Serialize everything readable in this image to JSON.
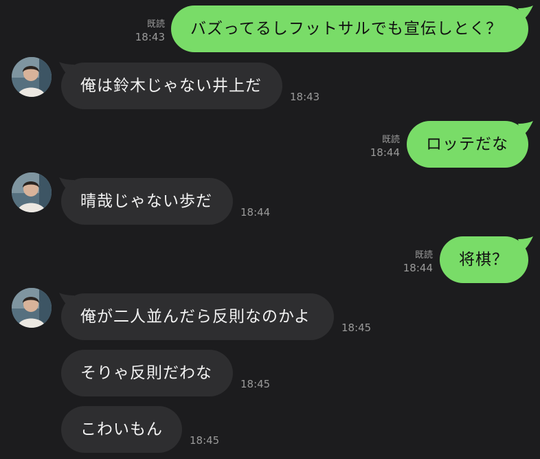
{
  "messages": [
    {
      "side": "out",
      "text": "バズってるしフットサルでも宣伝しとく？",
      "read": "既読",
      "time": "18:43"
    },
    {
      "side": "in",
      "text": "俺は鈴木じゃない井上だ",
      "time": "18:43",
      "avatar": true
    },
    {
      "side": "out",
      "text": "ロッテだな",
      "read": "既読",
      "time": "18:44"
    },
    {
      "side": "in",
      "text": "晴哉じゃない歩だ",
      "time": "18:44",
      "avatar": true
    },
    {
      "side": "out",
      "text": "将棋？",
      "read": "既読",
      "time": "18:44"
    },
    {
      "side": "in",
      "text": "俺が二人並んだら反則なのかよ",
      "time": "18:45",
      "avatar": true
    },
    {
      "side": "in",
      "text": "そりゃ反則だわな",
      "time": "18:45",
      "avatar": false
    },
    {
      "side": "in",
      "text": "こわいもん",
      "time": "18:45",
      "avatar": false
    }
  ],
  "colors": {
    "background": "#1c1c1e",
    "outgoing_bubble": "#79dc68",
    "incoming_bubble": "#2e2e30",
    "meta_text": "#9a9a9a"
  },
  "icons": {
    "avatar": "user-avatar-photo"
  }
}
